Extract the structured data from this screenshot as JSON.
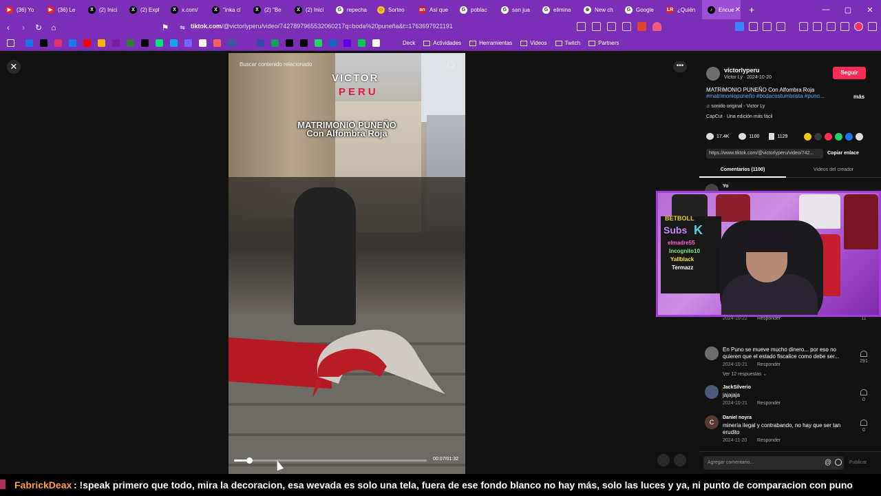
{
  "browser": {
    "tabs": [
      {
        "label": "(36) Yo",
        "fav": "#e6252c",
        "glyph": "▶"
      },
      {
        "label": "(36) Le",
        "fav": "#e6252c",
        "glyph": "▶"
      },
      {
        "label": "(2) Inici",
        "fav": "#000000",
        "glyph": "X"
      },
      {
        "label": "(2) Expl",
        "fav": "#000000",
        "glyph": "X"
      },
      {
        "label": "x.com/",
        "fav": "#000000",
        "glyph": "X"
      },
      {
        "label": "\"inka cl",
        "fav": "#000000",
        "glyph": "X"
      },
      {
        "label": "(2) \"Be",
        "fav": "#000000",
        "glyph": "X"
      },
      {
        "label": "(2) Inici",
        "fav": "#000000",
        "glyph": "X"
      },
      {
        "label": "repecha",
        "fav": "#ffffff",
        "glyph": "G"
      },
      {
        "label": "Sorteo",
        "fav": "#f2c21b",
        "glyph": "☺"
      },
      {
        "label": "Así que",
        "fav": "#d9202b",
        "glyph": "an"
      },
      {
        "label": "poblac",
        "fav": "#ffffff",
        "glyph": "G"
      },
      {
        "label": "san jua",
        "fav": "#ffffff",
        "glyph": "G"
      },
      {
        "label": "elimina",
        "fav": "#ffffff",
        "glyph": "G"
      },
      {
        "label": "New ch",
        "fav": "#ffffff",
        "glyph": "⊛"
      },
      {
        "label": "Google",
        "fav": "#ffffff",
        "glyph": "G"
      },
      {
        "label": "¿Quién",
        "fav": "#d9202b",
        "glyph": "LR"
      },
      {
        "label": "Encuer",
        "fav": "#000000",
        "glyph": "♪"
      }
    ],
    "window_controls": [
      "—",
      "▢",
      "✕"
    ],
    "url_domain": "tiktok.com",
    "url_path": "/@victorlyperu/video/7427897965532060217q=boda%20puneña&t=1763697921191",
    "bookmarks": [
      "Deck",
      "Actividades",
      "Herramientas",
      "Videos",
      "Twitch",
      "Partners"
    ],
    "bookmark_icon_colors": [
      "#1a73e8",
      "#000000",
      "#e1306c",
      "#1877f2",
      "#ff0000",
      "#f4b400",
      "#7b1fa2",
      "#2e7d32",
      "#000000",
      "#00e676",
      "#1da1f2",
      "#7b61ff",
      "#ffffff",
      "#ff5a5f",
      "#3b5998",
      "#7a2fb6",
      "#3949ab",
      "#0f9d58",
      "#000000",
      "#000000",
      "#25d366",
      "#1565c0",
      "#6200ea",
      "#00c853",
      "#ffffff",
      "#7a2fb6"
    ]
  },
  "video": {
    "search_placeholder": "Buscar contenido relacionado",
    "logo_top": "VICTOR",
    "logo_bottom": "PERU",
    "title_line1": "MATRIMONIO PUNEÑO",
    "title_line2": "Con Alfombra Roja",
    "progress_fraction": 0.08,
    "time": "00:07/01:32"
  },
  "sidebar": {
    "username": "victorlyperu",
    "user_sub": "Victor Ly · 2024-10-20",
    "follow_label": "Seguir",
    "description": "MATRIMONIO PUNEÑO Con Alfombra Roja",
    "hashtags": "#matrimoniopuneño #bodacostumbrista #puno...",
    "more_label": "más",
    "sound": "♫ sonido original - Victor Ly",
    "capcut": "CapCut · Una edición más fácil",
    "likes": "17.4K",
    "comments_count": "1100",
    "saves": "1129",
    "share_colors": [
      "#f5c518",
      "#3a3a3a",
      "#fe2c55",
      "#25d366",
      "#1877f2",
      "#dddddd"
    ],
    "link": "https://www.tiktok.com/@victorlyperu/video/742...",
    "copy_link": "Copiar enlace",
    "tab_comments": "Comentarios (1100)",
    "tab_videos": "Videos del creador",
    "first_comment_user": "Yo",
    "hidden_comment_date": "2024-10-22",
    "hidden_comment_reply": "Responder",
    "hidden_comment_likes": "11",
    "comments": [
      {
        "user": "",
        "text": "En Puno se mueve mucho dinero... por eso no quieren que el estado fiscalice como debe ser...",
        "date": "2024-10-21",
        "reply": "Responder",
        "likes": "291",
        "replies": "Ver 12 respuestas ⌄",
        "avatar_color": "#6b6b6b"
      },
      {
        "user": "JackSilverio",
        "text": "jajajaja",
        "date": "2024-10-21",
        "reply": "Responder",
        "likes": "0",
        "avatar_color": "#4a5a7a"
      },
      {
        "user": "Daniel noyra",
        "text": "minería ilegal y contrabando, no hay que ser tan erudito",
        "date": "2024-11-20",
        "reply": "Responder",
        "likes": "0",
        "avatar_letter": "C",
        "avatar_color": "#5a3a30"
      }
    ],
    "add_comment_placeholder": "Agregar comentario...",
    "publish_label": "Publicar"
  },
  "webcam": {
    "board_line1": "BETBOLL",
    "board_line2": "Subs",
    "board_line3": "K",
    "board_names": [
      "elmadre55",
      "Incognito10",
      "Yallblack",
      "Termazz"
    ]
  },
  "chat": {
    "username": "FabrickDeax",
    "message": ": !speak primero que todo, mira la decoracion, esa wevada es solo una tela, fuera de ese fondo blanco no hay más, solo las luces y ya, ni punto de comparacion con puno"
  }
}
